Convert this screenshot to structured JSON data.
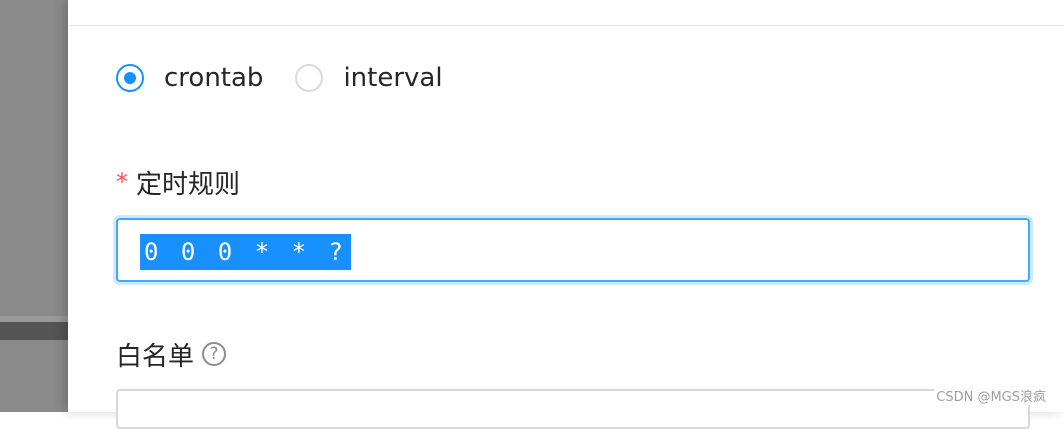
{
  "schedule_type": {
    "options": [
      {
        "label": "crontab",
        "checked": true
      },
      {
        "label": "interval",
        "checked": false
      }
    ]
  },
  "timing_rule": {
    "required_mark": "*",
    "label": "定时规则",
    "value": "0 0 0 * * ?"
  },
  "whitelist": {
    "label": "白名单",
    "help_icon": "question-circle-icon",
    "help_glyph": "?"
  },
  "watermark": "CSDN @MGS浪疯",
  "colors": {
    "accent": "#1890ff",
    "required": "#ff4d4f",
    "selection_bg": "#1890ff"
  }
}
